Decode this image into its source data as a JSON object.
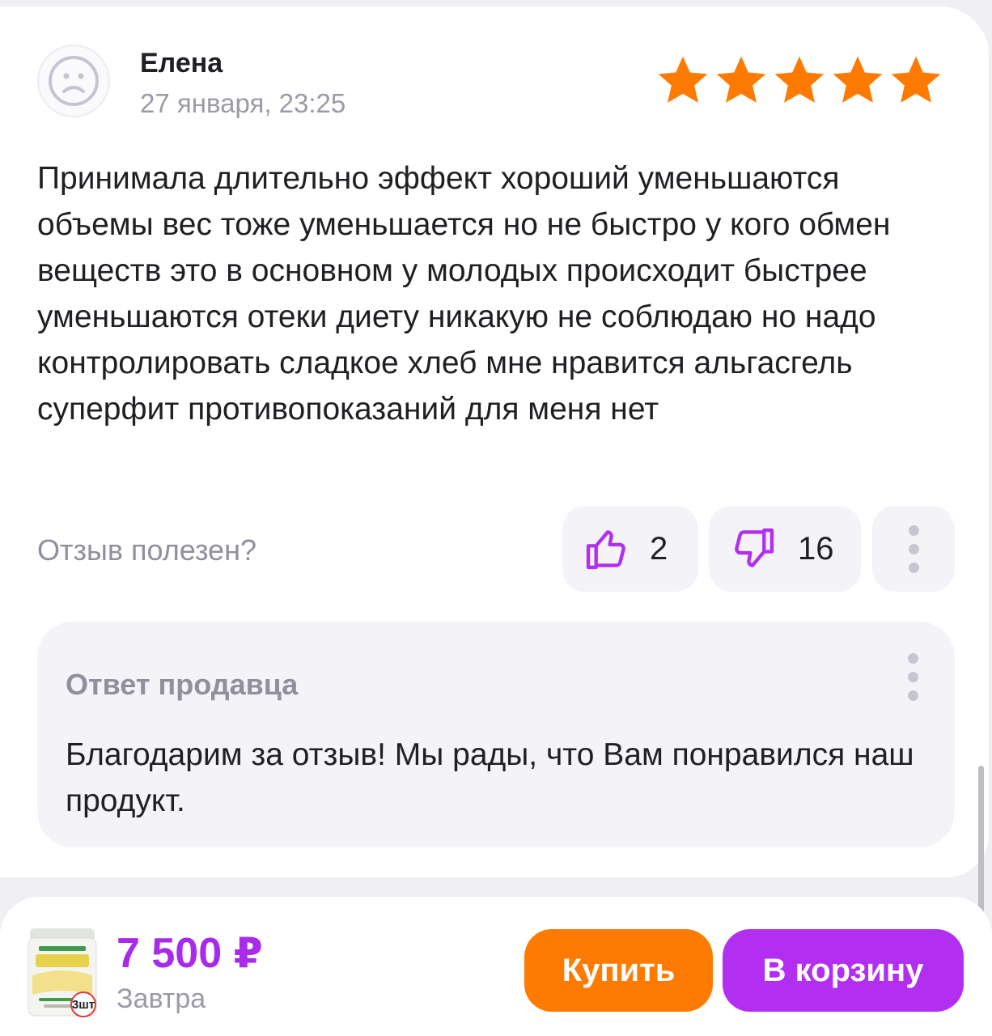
{
  "review": {
    "author": "Елена",
    "date": "27 января, 23:25",
    "rating": 5,
    "rating_max": 5,
    "text": "Принимала длительно эффект хороший уменьшаются объемы вес тоже уменьшается но не быстро у кого обмен веществ это в основном у молодых происходит быстрее уменьшаются отеки диету никакую не соблюдаю но надо контролировать сладкое хлеб мне нравится альгасгель суперфит противопоказаний для меня нет",
    "helpful_label": "Отзыв полезен?",
    "likes": "2",
    "dislikes": "16"
  },
  "seller_reply": {
    "title": "Ответ продавца",
    "text": "Благодарим за отзыв! Мы рады, что Вам понравился наш продукт."
  },
  "bottom_bar": {
    "price": "7 500 ₽",
    "delivery": "Завтра",
    "quantity_badge": "3шт",
    "buy_label": "Купить",
    "cart_label": "В корзину"
  },
  "colors": {
    "star": "#ff7a00",
    "accent_purple": "#b22ff2",
    "price": "#a72be8",
    "buy_button": "#ff7a00",
    "muted_text": "#8f8f9e"
  },
  "icons": {
    "avatar": "sad-face-icon",
    "like": "thumbs-up-icon",
    "dislike": "thumbs-down-icon",
    "more": "more-vertical-icon"
  }
}
